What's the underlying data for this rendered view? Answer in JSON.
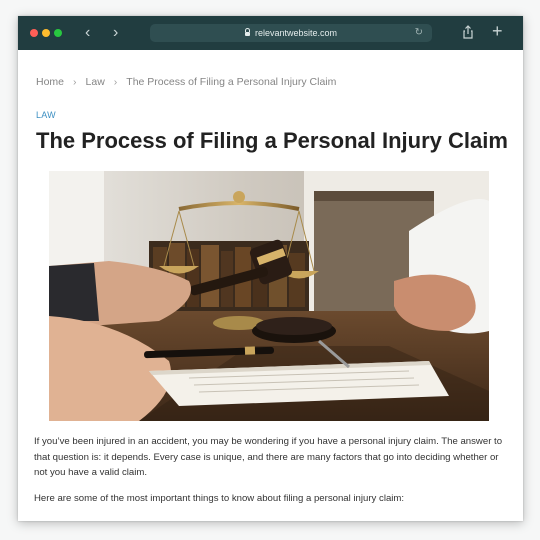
{
  "browser": {
    "url": "relevantwebsite.com",
    "back_icon": "chevron-left-icon",
    "forward_icon": "chevron-right-icon",
    "share_icon": "share-icon",
    "new_tab_icon": "plus-icon"
  },
  "breadcrumb": {
    "home": "Home",
    "category": "Law",
    "current": "The Process of Filing a Personal Injury Claim"
  },
  "article": {
    "category": "LAW",
    "title": "The Process of Filing a Personal Injury Claim",
    "paragraphs": [
      "If you’ve been injured in an accident, you may be wondering if you have a personal injury claim. The answer to that question is: it depends. Every case is unique, and there are many factors that go into deciding whether or not you have a valid claim.",
      "Here are some of the most important things to know about filing a personal injury claim:"
    ]
  },
  "colors": {
    "toolbar": "#213d40",
    "link_blue": "#3c8fc2",
    "title_text": "#222222"
  }
}
